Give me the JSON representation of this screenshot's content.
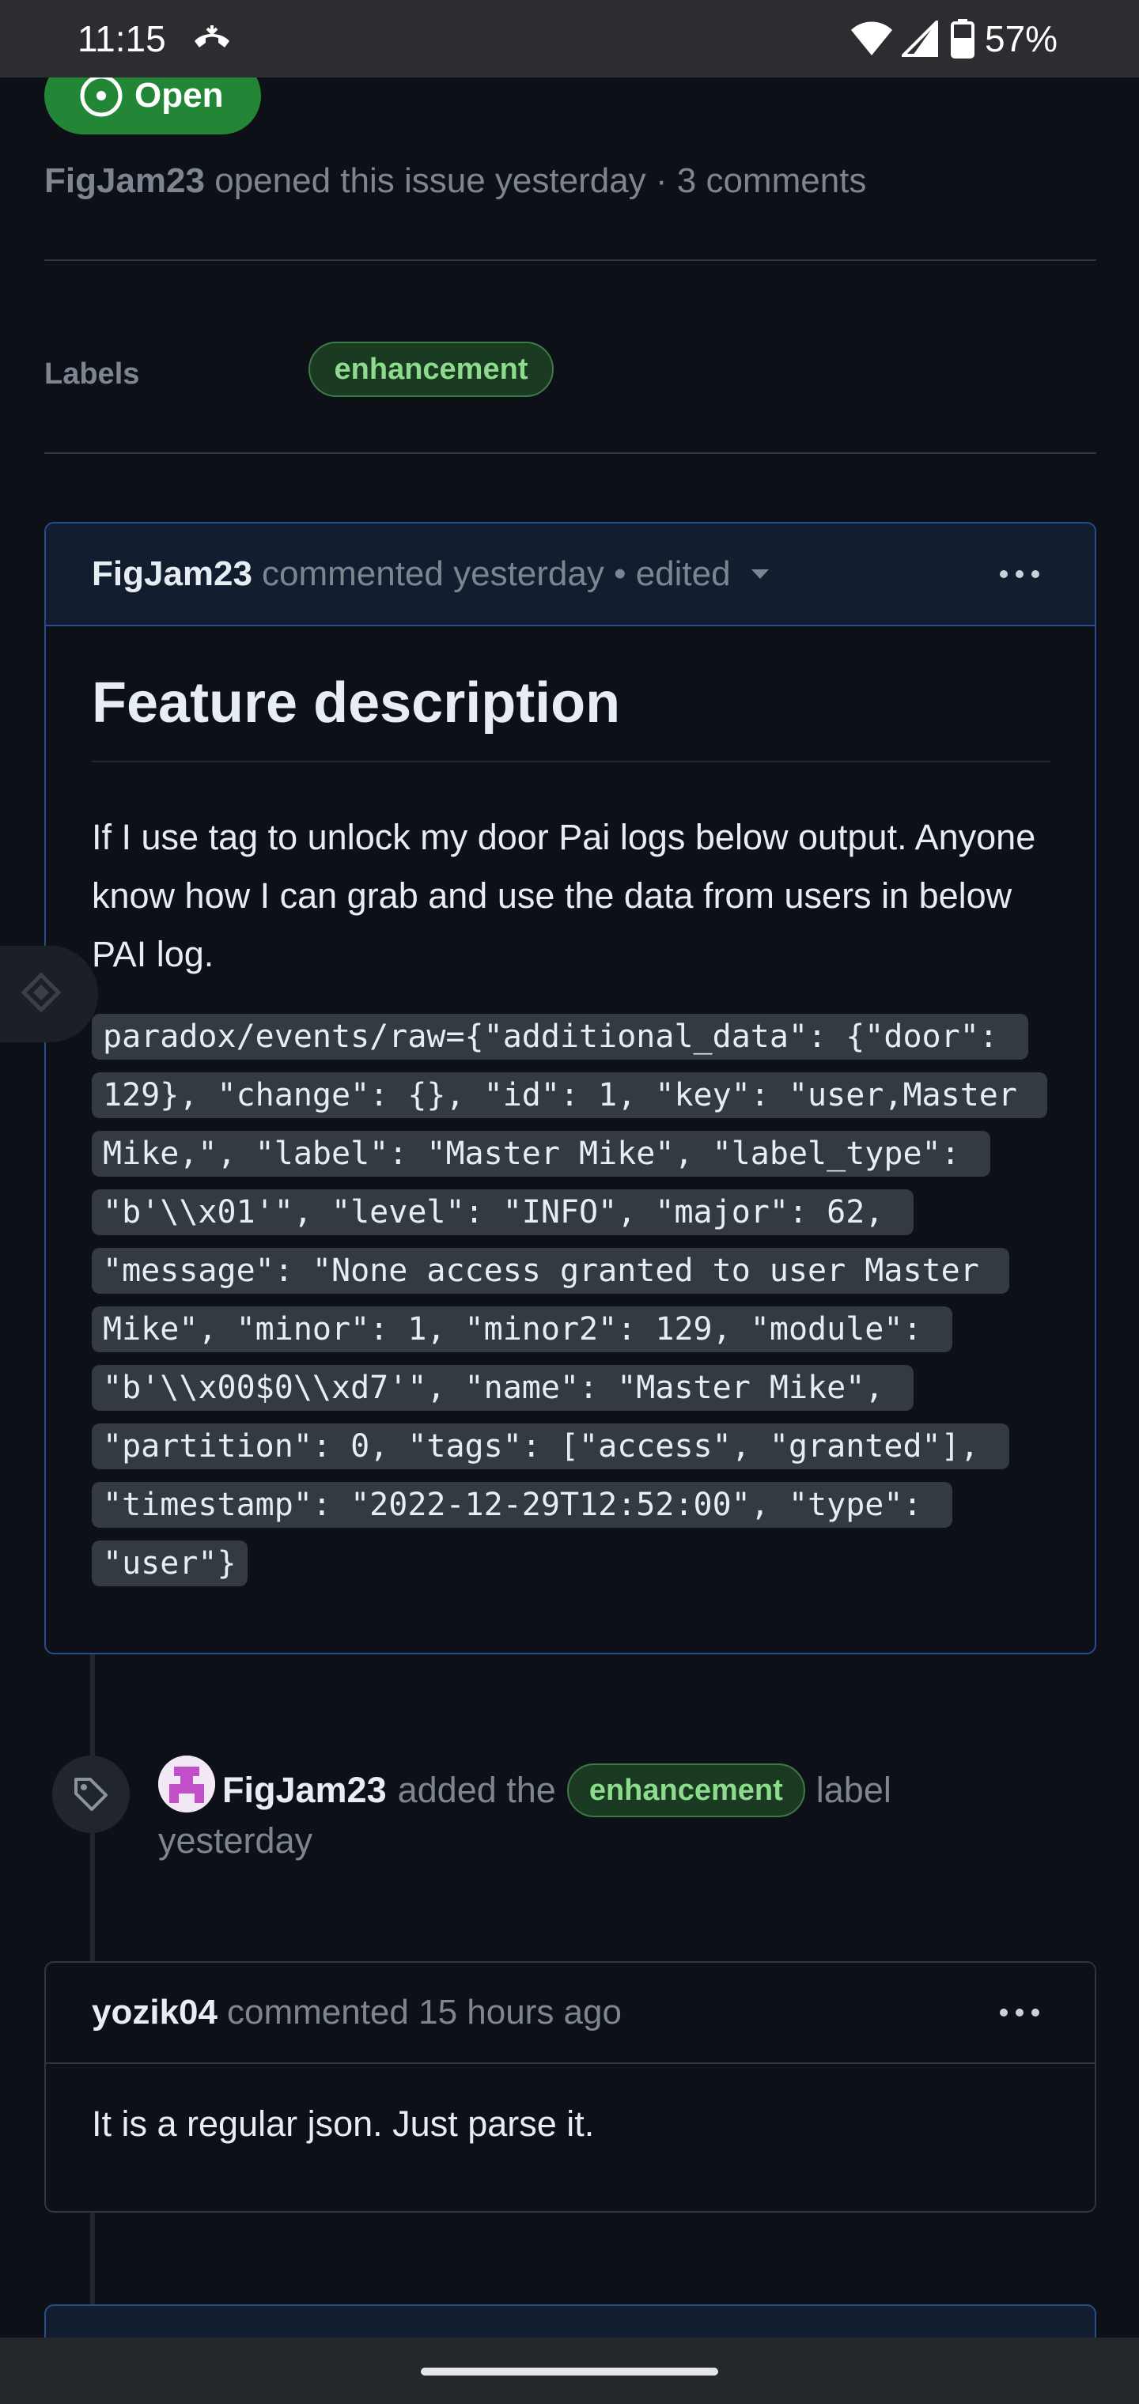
{
  "status_bar": {
    "time": "11:15",
    "battery": "57%"
  },
  "issue": {
    "state_label": "Open",
    "author": "FigJam23",
    "meta_text": "opened this issue yesterday · 3 comments",
    "labels_heading": "Labels",
    "label": "enhancement"
  },
  "comment1": {
    "author": "FigJam23",
    "meta": "commented yesterday • edited",
    "title": "Feature description",
    "paragraph": "If I use tag to unlock my door Pai logs below output. Anyone know how I can grab and use the data from users in below PAI log.",
    "code": "paradox/events/raw={\"additional_data\": {\"door\": 129}, \"change\": {}, \"id\": 1, \"key\": \"user,Master Mike,\", \"label\": \"Master Mike\", \"label_type\": \"b'\\\\x01'\", \"level\": \"INFO\", \"major\": 62, \"message\": \"None access granted to user Master Mike\", \"minor\": 1, \"minor2\": 129, \"module\": \"b'\\\\x00$0\\\\xd7'\", \"name\": \"Master Mike\", \"partition\": 0, \"tags\": [\"access\", \"granted\"], \"timestamp\": \"2022-12-29T12:52:00\", \"type\": \"user\"}"
  },
  "event": {
    "author": "FigJam23",
    "action": "added the",
    "label": "enhancement",
    "suffix": "label",
    "time": "yesterday"
  },
  "comment2": {
    "author": "yozik04",
    "meta": "commented 15 hours ago",
    "body": "It is a regular json. Just parse it."
  },
  "colors": {
    "open_green": "#238636",
    "label_text": "#8ddb8c",
    "accent_border": "#264d8c",
    "background": "#0d1117"
  }
}
